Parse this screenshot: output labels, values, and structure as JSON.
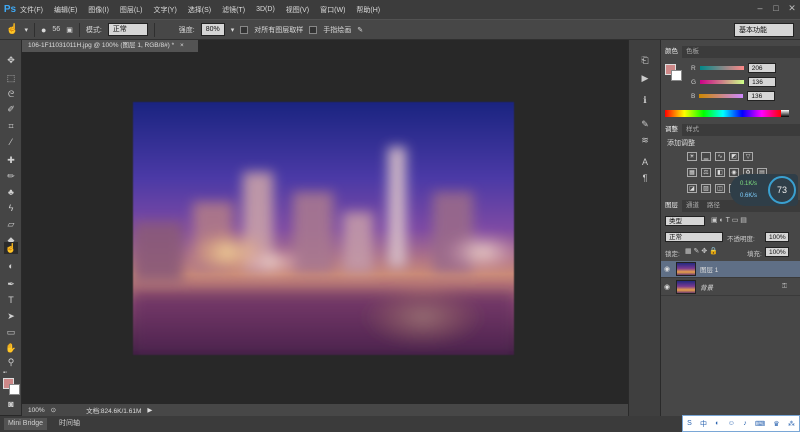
{
  "app": {
    "logo": "Ps"
  },
  "menu": [
    "文件(F)",
    "编辑(E)",
    "图像(I)",
    "图层(L)",
    "文字(Y)",
    "选择(S)",
    "滤镜(T)",
    "3D(D)",
    "视图(V)",
    "窗口(W)",
    "帮助(H)"
  ],
  "options": {
    "brush_size": "56",
    "mode_label": "模式:",
    "mode_value": "正常",
    "strength_label": "强度:",
    "strength_value": "80%",
    "sample_all_label": "对所有图层取样",
    "finger_paint_label": "手指绘画",
    "workspace": "基本功能"
  },
  "document": {
    "tab_title": "106-1F11031011H.jpg @ 100% (图层 1, RGB/8#) *",
    "zoom": "100%",
    "doc_info": "文档:824.6K/1.61M"
  },
  "bottom_tabs": [
    "Mini Bridge",
    "时间轴"
  ],
  "color_panel": {
    "tabs": [
      "颜色",
      "色板"
    ],
    "r_label": "R",
    "r_value": "206",
    "g_label": "G",
    "g_value": "136",
    "b_label": "B",
    "b_value": "136",
    "foreground": "#ce8888"
  },
  "adjustments": {
    "tabs": [
      "调整",
      "样式"
    ],
    "title": "添加调整"
  },
  "layers_panel": {
    "tabs": [
      "图层",
      "通道",
      "路径"
    ],
    "kind": "类型",
    "blend": "正常",
    "opacity_label": "不透明度:",
    "opacity_value": "100%",
    "lock_label": "锁定:",
    "fill_label": "填充:",
    "fill_value": "100%",
    "layers": [
      {
        "name": "图层 1"
      },
      {
        "name": "背景"
      }
    ]
  },
  "speed_widget": {
    "up": "0.1K/s",
    "down": "0.6K/s",
    "percent": "73"
  },
  "colors": {
    "accent": "#3fa9f5",
    "selected_layer": "#5f6f86"
  }
}
